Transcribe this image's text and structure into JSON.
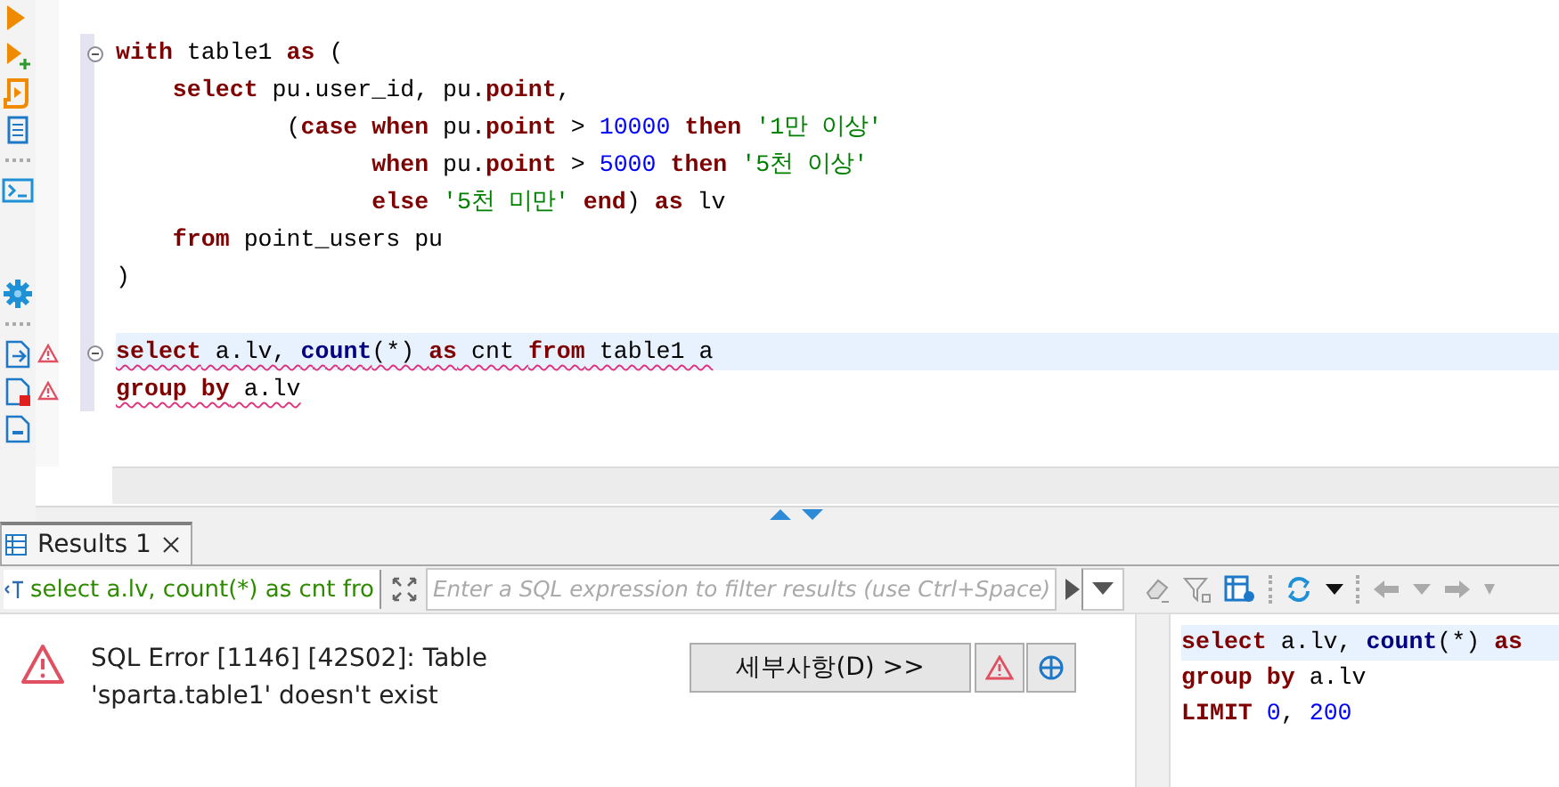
{
  "editor": {
    "lines": [
      {
        "fold": true,
        "error": false,
        "current": false,
        "tokens": [
          {
            "kind": "kw",
            "t": "with"
          },
          {
            "kind": "plain",
            "t": " table1 "
          },
          {
            "kind": "kw",
            "t": "as"
          },
          {
            "kind": "plain",
            "t": " ("
          }
        ]
      },
      {
        "fold": false,
        "error": false,
        "current": false,
        "tokens": [
          {
            "kind": "kw",
            "t": "    select"
          },
          {
            "kind": "plain",
            "t": " pu.user_id, pu."
          },
          {
            "kind": "kw",
            "t": "point"
          },
          {
            "kind": "plain",
            "t": ","
          }
        ]
      },
      {
        "fold": false,
        "error": false,
        "current": false,
        "tokens": [
          {
            "kind": "plain",
            "t": "            ("
          },
          {
            "kind": "kw",
            "t": "case when"
          },
          {
            "kind": "plain",
            "t": " pu."
          },
          {
            "kind": "kw",
            "t": "point"
          },
          {
            "kind": "plain",
            "t": " > "
          },
          {
            "kind": "num",
            "t": "10000"
          },
          {
            "kind": "kw",
            "t": " then "
          },
          {
            "kind": "str",
            "t": "'1만 이상'"
          }
        ]
      },
      {
        "fold": false,
        "error": false,
        "current": false,
        "tokens": [
          {
            "kind": "kw",
            "t": "                  when"
          },
          {
            "kind": "plain",
            "t": " pu."
          },
          {
            "kind": "kw",
            "t": "point"
          },
          {
            "kind": "plain",
            "t": " > "
          },
          {
            "kind": "num",
            "t": "5000"
          },
          {
            "kind": "kw",
            "t": " then "
          },
          {
            "kind": "str",
            "t": "'5천 이상'"
          }
        ]
      },
      {
        "fold": false,
        "error": false,
        "current": false,
        "tokens": [
          {
            "kind": "kw",
            "t": "                  else "
          },
          {
            "kind": "str",
            "t": "'5천 미만'"
          },
          {
            "kind": "kw",
            "t": " end"
          },
          {
            "kind": "plain",
            "t": ") "
          },
          {
            "kind": "kw",
            "t": "as"
          },
          {
            "kind": "plain",
            "t": " lv"
          }
        ]
      },
      {
        "fold": false,
        "error": false,
        "current": false,
        "tokens": [
          {
            "kind": "kw",
            "t": "    from"
          },
          {
            "kind": "plain",
            "t": " point_users pu"
          }
        ]
      },
      {
        "fold": false,
        "error": false,
        "current": false,
        "tokens": [
          {
            "kind": "plain",
            "t": ")"
          }
        ]
      },
      {
        "fold": false,
        "error": false,
        "current": false
      },
      {
        "fold": true,
        "error": true,
        "current": true,
        "tokens": [
          {
            "kind": "kw",
            "t": "select"
          },
          {
            "kind": "plain",
            "t": " a.lv, "
          },
          {
            "kind": "fn",
            "t": "count"
          },
          {
            "kind": "plain",
            "t": "(*) "
          },
          {
            "kind": "kw",
            "t": "as"
          },
          {
            "kind": "plain",
            "t": " cnt "
          },
          {
            "kind": "kw",
            "t": "from"
          },
          {
            "kind": "plain",
            "t": " table1 a"
          }
        ]
      },
      {
        "fold": false,
        "error": true,
        "current": false,
        "tokens": [
          {
            "kind": "kw",
            "t": "group by"
          },
          {
            "kind": "plain",
            "t": " a.lv"
          }
        ]
      }
    ]
  },
  "results": {
    "tabs": [
      {
        "label": "Results 1",
        "selected": true
      }
    ],
    "filter": {
      "query": "select a.lv, count(*) as cnt fro",
      "placeholder": "Enter a SQL expression to filter results (use Ctrl+Space)"
    },
    "error": {
      "message": "SQL Error [1146] [42S02]: Table 'sparta.table1' doesn't exist",
      "details_button": "세부사항(D) >>"
    },
    "query_lines": [
      {
        "current": true,
        "tokens": [
          {
            "kind": "kw",
            "t": "select"
          },
          {
            "kind": "plain",
            "t": " a.lv, "
          },
          {
            "kind": "fn",
            "t": "count"
          },
          {
            "kind": "plain",
            "t": "(*) "
          },
          {
            "kind": "kw",
            "t": "as"
          }
        ]
      },
      {
        "current": false,
        "tokens": [
          {
            "kind": "kw",
            "t": "group by"
          },
          {
            "kind": "plain",
            "t": " a.lv"
          }
        ]
      },
      {
        "current": false,
        "tokens": [
          {
            "kind": "kw",
            "t": "LIMIT "
          },
          {
            "kind": "num",
            "t": "0"
          },
          {
            "kind": "plain",
            "t": ", "
          },
          {
            "kind": "num",
            "t": "200"
          }
        ]
      }
    ]
  }
}
